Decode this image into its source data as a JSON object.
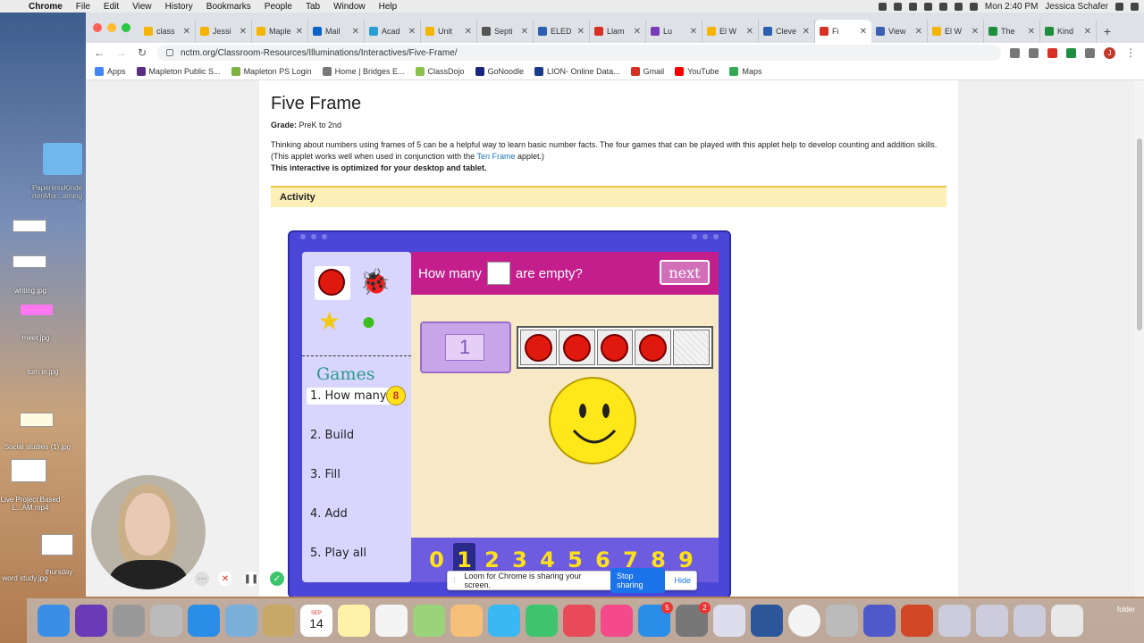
{
  "menubar": {
    "apple": "",
    "items": [
      "Chrome",
      "File",
      "Edit",
      "View",
      "History",
      "Bookmarks",
      "People",
      "Tab",
      "Window",
      "Help"
    ],
    "clock": "Mon 2:40 PM",
    "user": "Jessica Schafer"
  },
  "tabs": [
    {
      "label": "class",
      "color": "#f4b400"
    },
    {
      "label": "Jessi",
      "color": "#f4b400"
    },
    {
      "label": "Maple",
      "color": "#f4b400"
    },
    {
      "label": "Mail",
      "color": "#0a64c8"
    },
    {
      "label": "Acad",
      "color": "#2a9fd6"
    },
    {
      "label": "Unit",
      "color": "#f4b400"
    },
    {
      "label": "Septi",
      "color": "#555555"
    },
    {
      "label": "ELED",
      "color": "#2c5fb0"
    },
    {
      "label": "Llam",
      "color": "#d93025"
    },
    {
      "label": "Lu",
      "color": "#7a3db8"
    },
    {
      "label": "El W",
      "color": "#f4b400"
    },
    {
      "label": "Cleve",
      "color": "#2c5fb0"
    },
    {
      "label": "Fi",
      "color": "#d93025",
      "active": true
    },
    {
      "label": "View",
      "color": "#3a5fb0"
    },
    {
      "label": "El W",
      "color": "#f4b400"
    },
    {
      "label": "The",
      "color": "#1e8e3e"
    },
    {
      "label": "Kind",
      "color": "#1e8e3e"
    }
  ],
  "address": "nctm.org/Classroom-Resources/Illuminations/Interactives/Five-Frame/",
  "avatar_letter": "J",
  "bookmarks": [
    {
      "label": "Apps",
      "color": "#4285f4"
    },
    {
      "label": "Mapleton Public S...",
      "color": "#5a2d82"
    },
    {
      "label": "Mapleton PS Login",
      "color": "#7cb342"
    },
    {
      "label": "Home | Bridges E...",
      "color": "#777777"
    },
    {
      "label": "ClassDojo",
      "color": "#8bc34a"
    },
    {
      "label": "GoNoodle",
      "color": "#1a237e"
    },
    {
      "label": "LION- Online Data...",
      "color": "#1a3a8a"
    },
    {
      "label": "Gmail",
      "color": "#d93025"
    },
    {
      "label": "YouTube",
      "color": "#ff0000"
    },
    {
      "label": "Maps",
      "color": "#34a853"
    }
  ],
  "page": {
    "title": "Five Frame",
    "grade_label": "Grade:",
    "grade_value": " PreK to 2nd",
    "desc1": "Thinking about numbers using frames of 5 can be a helpful way to learn basic number facts. The four games that can be played with this applet help to develop counting and addition skills. (This applet works well when used in conjunction with the ",
    "desc_link": "Ten Frame",
    "desc2": " applet.)",
    "optimized": "This interactive is optimized for your desktop and tablet.",
    "activity_header": "Activity"
  },
  "applet": {
    "question_pre": "How many",
    "question_post": "are empty?",
    "next_label": "next",
    "games_title": "Games",
    "games": [
      "1. How many?",
      "2. Build",
      "3. Fill",
      "4. Add",
      "5. Play all"
    ],
    "badge_value": "8",
    "answer_value": "1",
    "frame_filled": 4,
    "frame_total": 5,
    "numbers": [
      "0",
      "1",
      "2",
      "3",
      "4",
      "5",
      "6",
      "7",
      "8",
      "9"
    ],
    "selected_number": "1",
    "icons": [
      "red-circle",
      "ladybug",
      "star",
      "apple"
    ]
  },
  "desktop": {
    "labels": [
      "PaperlessKinde rtenMor...arning",
      "writing.jpg",
      "meet.jpg",
      "turn in.jpg",
      "Social studies (1).jpg",
      "Live Project Based L...AM.mp4",
      "thursday",
      "word study.jpg",
      "folder"
    ]
  },
  "loom": {
    "message": "Loom for Chrome is sharing your screen.",
    "stop": "Stop sharing",
    "hide": "Hide"
  },
  "dock": {
    "date_badge": "14",
    "calendar_month": "SEP",
    "badge_appstore": "5",
    "badge_settings": "2"
  }
}
